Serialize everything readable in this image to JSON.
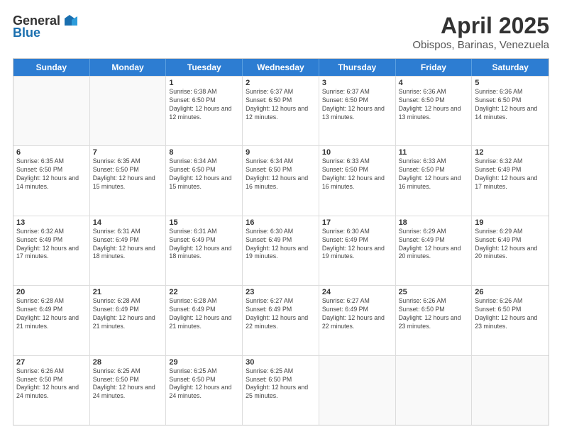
{
  "header": {
    "logo_general": "General",
    "logo_blue": "Blue",
    "title": "April 2025",
    "subtitle": "Obispos, Barinas, Venezuela"
  },
  "weekdays": [
    "Sunday",
    "Monday",
    "Tuesday",
    "Wednesday",
    "Thursday",
    "Friday",
    "Saturday"
  ],
  "weeks": [
    [
      {
        "day": "",
        "info": ""
      },
      {
        "day": "",
        "info": ""
      },
      {
        "day": "1",
        "info": "Sunrise: 6:38 AM\nSunset: 6:50 PM\nDaylight: 12 hours and 12 minutes."
      },
      {
        "day": "2",
        "info": "Sunrise: 6:37 AM\nSunset: 6:50 PM\nDaylight: 12 hours and 12 minutes."
      },
      {
        "day": "3",
        "info": "Sunrise: 6:37 AM\nSunset: 6:50 PM\nDaylight: 12 hours and 13 minutes."
      },
      {
        "day": "4",
        "info": "Sunrise: 6:36 AM\nSunset: 6:50 PM\nDaylight: 12 hours and 13 minutes."
      },
      {
        "day": "5",
        "info": "Sunrise: 6:36 AM\nSunset: 6:50 PM\nDaylight: 12 hours and 14 minutes."
      }
    ],
    [
      {
        "day": "6",
        "info": "Sunrise: 6:35 AM\nSunset: 6:50 PM\nDaylight: 12 hours and 14 minutes."
      },
      {
        "day": "7",
        "info": "Sunrise: 6:35 AM\nSunset: 6:50 PM\nDaylight: 12 hours and 15 minutes."
      },
      {
        "day": "8",
        "info": "Sunrise: 6:34 AM\nSunset: 6:50 PM\nDaylight: 12 hours and 15 minutes."
      },
      {
        "day": "9",
        "info": "Sunrise: 6:34 AM\nSunset: 6:50 PM\nDaylight: 12 hours and 16 minutes."
      },
      {
        "day": "10",
        "info": "Sunrise: 6:33 AM\nSunset: 6:50 PM\nDaylight: 12 hours and 16 minutes."
      },
      {
        "day": "11",
        "info": "Sunrise: 6:33 AM\nSunset: 6:50 PM\nDaylight: 12 hours and 16 minutes."
      },
      {
        "day": "12",
        "info": "Sunrise: 6:32 AM\nSunset: 6:49 PM\nDaylight: 12 hours and 17 minutes."
      }
    ],
    [
      {
        "day": "13",
        "info": "Sunrise: 6:32 AM\nSunset: 6:49 PM\nDaylight: 12 hours and 17 minutes."
      },
      {
        "day": "14",
        "info": "Sunrise: 6:31 AM\nSunset: 6:49 PM\nDaylight: 12 hours and 18 minutes."
      },
      {
        "day": "15",
        "info": "Sunrise: 6:31 AM\nSunset: 6:49 PM\nDaylight: 12 hours and 18 minutes."
      },
      {
        "day": "16",
        "info": "Sunrise: 6:30 AM\nSunset: 6:49 PM\nDaylight: 12 hours and 19 minutes."
      },
      {
        "day": "17",
        "info": "Sunrise: 6:30 AM\nSunset: 6:49 PM\nDaylight: 12 hours and 19 minutes."
      },
      {
        "day": "18",
        "info": "Sunrise: 6:29 AM\nSunset: 6:49 PM\nDaylight: 12 hours and 20 minutes."
      },
      {
        "day": "19",
        "info": "Sunrise: 6:29 AM\nSunset: 6:49 PM\nDaylight: 12 hours and 20 minutes."
      }
    ],
    [
      {
        "day": "20",
        "info": "Sunrise: 6:28 AM\nSunset: 6:49 PM\nDaylight: 12 hours and 21 minutes."
      },
      {
        "day": "21",
        "info": "Sunrise: 6:28 AM\nSunset: 6:49 PM\nDaylight: 12 hours and 21 minutes."
      },
      {
        "day": "22",
        "info": "Sunrise: 6:28 AM\nSunset: 6:49 PM\nDaylight: 12 hours and 21 minutes."
      },
      {
        "day": "23",
        "info": "Sunrise: 6:27 AM\nSunset: 6:49 PM\nDaylight: 12 hours and 22 minutes."
      },
      {
        "day": "24",
        "info": "Sunrise: 6:27 AM\nSunset: 6:49 PM\nDaylight: 12 hours and 22 minutes."
      },
      {
        "day": "25",
        "info": "Sunrise: 6:26 AM\nSunset: 6:50 PM\nDaylight: 12 hours and 23 minutes."
      },
      {
        "day": "26",
        "info": "Sunrise: 6:26 AM\nSunset: 6:50 PM\nDaylight: 12 hours and 23 minutes."
      }
    ],
    [
      {
        "day": "27",
        "info": "Sunrise: 6:26 AM\nSunset: 6:50 PM\nDaylight: 12 hours and 24 minutes."
      },
      {
        "day": "28",
        "info": "Sunrise: 6:25 AM\nSunset: 6:50 PM\nDaylight: 12 hours and 24 minutes."
      },
      {
        "day": "29",
        "info": "Sunrise: 6:25 AM\nSunset: 6:50 PM\nDaylight: 12 hours and 24 minutes."
      },
      {
        "day": "30",
        "info": "Sunrise: 6:25 AM\nSunset: 6:50 PM\nDaylight: 12 hours and 25 minutes."
      },
      {
        "day": "",
        "info": ""
      },
      {
        "day": "",
        "info": ""
      },
      {
        "day": "",
        "info": ""
      }
    ]
  ]
}
